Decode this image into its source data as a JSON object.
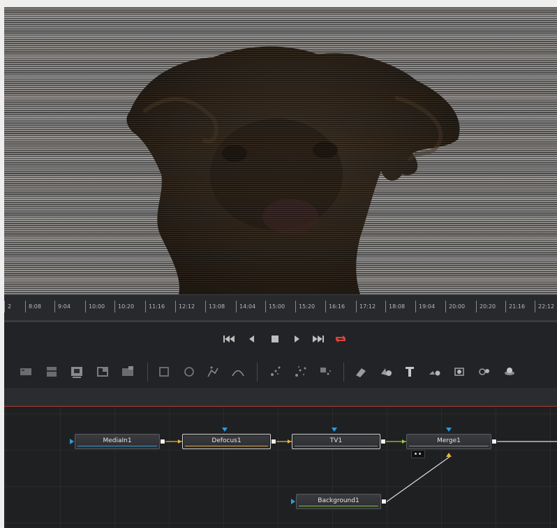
{
  "timeline": {
    "ticks": [
      "2",
      "8:08",
      "9:04",
      "10:00",
      "10:20",
      "11:16",
      "12:12",
      "13:08",
      "14:04",
      "15:00",
      "15:20",
      "16:16",
      "17:12",
      "18:08",
      "19:04",
      "20:00",
      "20:20",
      "21:16",
      "22:12"
    ]
  },
  "transport": {
    "buttons": [
      "skip-to-start",
      "play-reverse",
      "stop",
      "play-forward",
      "skip-to-end",
      "loop"
    ],
    "loop_color": "#e0453a"
  },
  "toolbar": {
    "tools": [
      "background-tool",
      "paint-tool",
      "text-tool",
      "transform-tool",
      "merge-tool",
      "rectangle-mask",
      "ellipse-mask",
      "polygon-mask",
      "bspline-mask",
      "particle-emitter",
      "particle-render",
      "particle-style",
      "shape-3d",
      "image-plane-3d",
      "text-3d",
      "merge-3d",
      "renderer-3d",
      "camera-3d",
      "light-3d"
    ]
  },
  "nodes": {
    "media_in": {
      "label": "MediaIn1",
      "color": "#2f9bdb"
    },
    "defocus": {
      "label": "Defocus1",
      "color": "#e8a23a"
    },
    "tv": {
      "label": "TV1",
      "color": "#8a8a8a"
    },
    "merge": {
      "label": "Merge1",
      "color": "#8a8a8a"
    },
    "background": {
      "label": "Background1",
      "color": "#7fbf3f"
    }
  },
  "colors": {
    "input_arrow": "#2f9bdb",
    "foreground_arrow": "#e8b63a",
    "link_yellow": "#e8b63a",
    "link_green": "#9fcf3a",
    "link_white": "#e0e0e0",
    "header_accent": "#b23b30"
  }
}
